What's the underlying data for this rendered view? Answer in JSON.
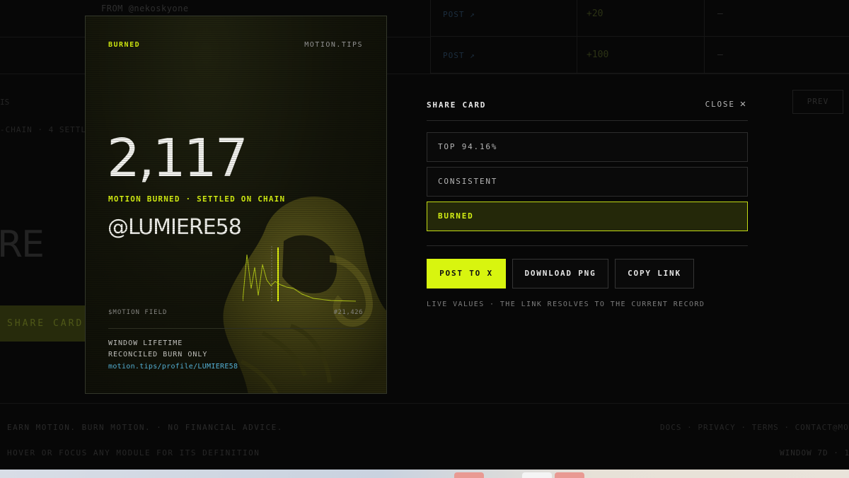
{
  "background": {
    "from_text": "FROM @nekoskyone",
    "rows": [
      {
        "action": "POST ↗",
        "delta": "+20",
        "dash": "—"
      },
      {
        "action": "POST ↗",
        "delta": "+100",
        "dash": "—"
      }
    ],
    "left_fragment_a": "IS",
    "left_fragment_b": "-CHAIN · 4 SETTL",
    "prev_label": "PREV",
    "big_fragment": "RE",
    "share_card_label": "SHARE CARD",
    "footer_disclaimer": "EARN MOTION. BURN MOTION. · NO FINANCIAL ADVICE.",
    "footer_hint": "HOVER OR FOCUS ANY MODULE FOR ITS DEFINITION",
    "footer_links": "DOCS · PRIVACY · TERMS · CONTACT@MO",
    "window_label": "WINDOW 7D · 1"
  },
  "card": {
    "badge": "BURNED",
    "site": "MOTION.TIPS",
    "value": "2,117",
    "subtitle": "MOTION BURNED · SETTLED ON CHAIN",
    "handle": "@LUMIERE58",
    "field_label": "$MOTION FIELD",
    "rank": "#21,426",
    "window_line": "WINDOW LIFETIME",
    "scope_line": "RECONCILED BURN ONLY",
    "profile_url": "motion.tips/profile/LUMIERE58",
    "accent_color": "#d6ef10"
  },
  "panel": {
    "title": "SHARE CARD",
    "close_label": "CLOSE",
    "close_icon": "close-icon",
    "options": [
      {
        "label": "TOP 94.16%",
        "selected": false
      },
      {
        "label": "CONSISTENT",
        "selected": false
      },
      {
        "label": "BURNED",
        "selected": true
      }
    ],
    "actions": {
      "post": "POST TO X",
      "download": "DOWNLOAD PNG",
      "copy": "COPY LINK"
    },
    "note": "LIVE VALUES · THE LINK RESOLVES TO THE CURRENT RECORD"
  }
}
